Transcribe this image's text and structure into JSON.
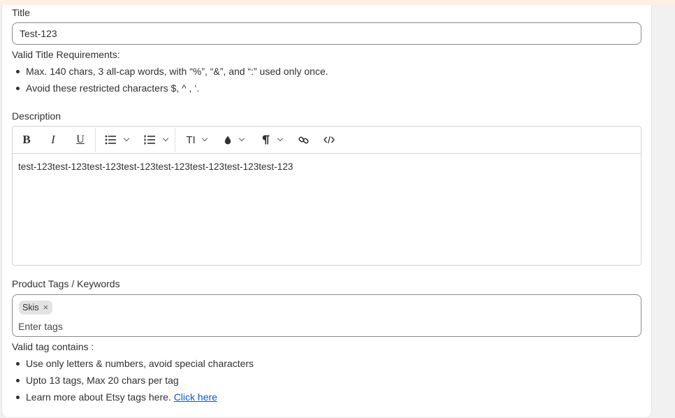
{
  "title_field": {
    "label": "Title",
    "value": "Test-123",
    "requirements_heading": "Valid Title Requirements:",
    "requirements": [
      "Max. 140 chars, 3 all-cap words, with “%”, “&”, and “:” used only once.",
      "Avoid these restricted characters $, ^ , ‘."
    ]
  },
  "description_field": {
    "label": "Description",
    "content": "test-123test-123test-123test-123test-123test-123test-123test-123",
    "toolbar": {
      "bold": "B",
      "italic": "I",
      "underline": "U",
      "text_size": "TI"
    }
  },
  "tags_field": {
    "label": "Product Tags / Keywords",
    "tags": [
      {
        "label": "Skis"
      }
    ],
    "remove_glyph": "×",
    "placeholder": "Enter tags",
    "rules_heading": "Valid tag contains :",
    "rules": [
      "Use only letters & numbers, avoid special characters",
      "Upto 13 tags, Max 20 chars per tag"
    ],
    "learn_more_text": "Learn more about Etsy tags here.",
    "learn_more_link": "Click here"
  },
  "colors": {
    "link": "#005bd3",
    "border": "#8a8a8a",
    "chip_bg": "#e3e3e3"
  }
}
